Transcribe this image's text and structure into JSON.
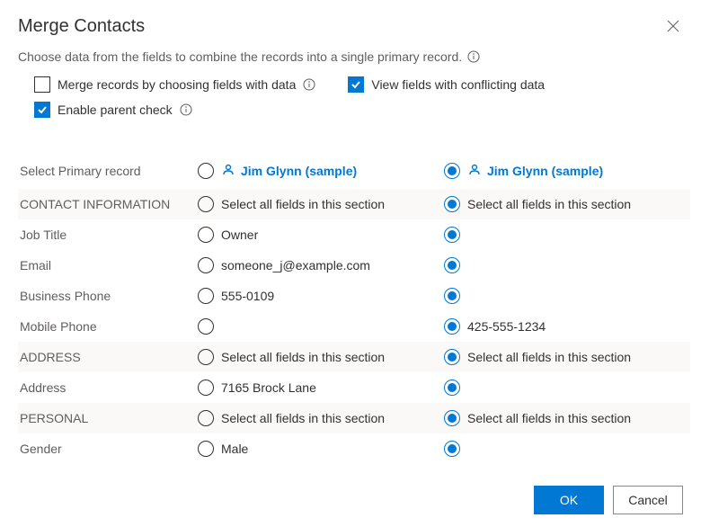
{
  "dialog": {
    "title": "Merge Contacts",
    "subtext": "Choose data from the fields to combine the records into a single primary record.",
    "options": {
      "merge_by_fields": {
        "label": "Merge records by choosing fields with data",
        "checked": false
      },
      "view_conflicts": {
        "label": "View fields with conflicting data",
        "checked": true
      },
      "enable_parent": {
        "label": "Enable parent check",
        "checked": true
      }
    },
    "primary_label": "Select Primary record",
    "records": [
      {
        "name": "Jim Glynn (sample)",
        "selected": false
      },
      {
        "name": "Jim Glynn (sample)",
        "selected": true
      }
    ],
    "section_text": "Select all fields in this section",
    "sections": [
      {
        "header": "CONTACT INFORMATION",
        "fields": [
          {
            "label": "Job Title",
            "v1": "Owner",
            "v2": ""
          },
          {
            "label": "Email",
            "v1": "someone_j@example.com",
            "v2": ""
          },
          {
            "label": "Business Phone",
            "v1": "555-0109",
            "v2": ""
          },
          {
            "label": "Mobile Phone",
            "v1": "",
            "v2": "425-555-1234"
          }
        ]
      },
      {
        "header": "ADDRESS",
        "fields": [
          {
            "label": "Address",
            "v1": "7165 Brock Lane",
            "v2": ""
          }
        ]
      },
      {
        "header": "PERSONAL",
        "fields": [
          {
            "label": "Gender",
            "v1": "Male",
            "v2": ""
          }
        ]
      }
    ],
    "footer": {
      "ok": "OK",
      "cancel": "Cancel"
    }
  }
}
